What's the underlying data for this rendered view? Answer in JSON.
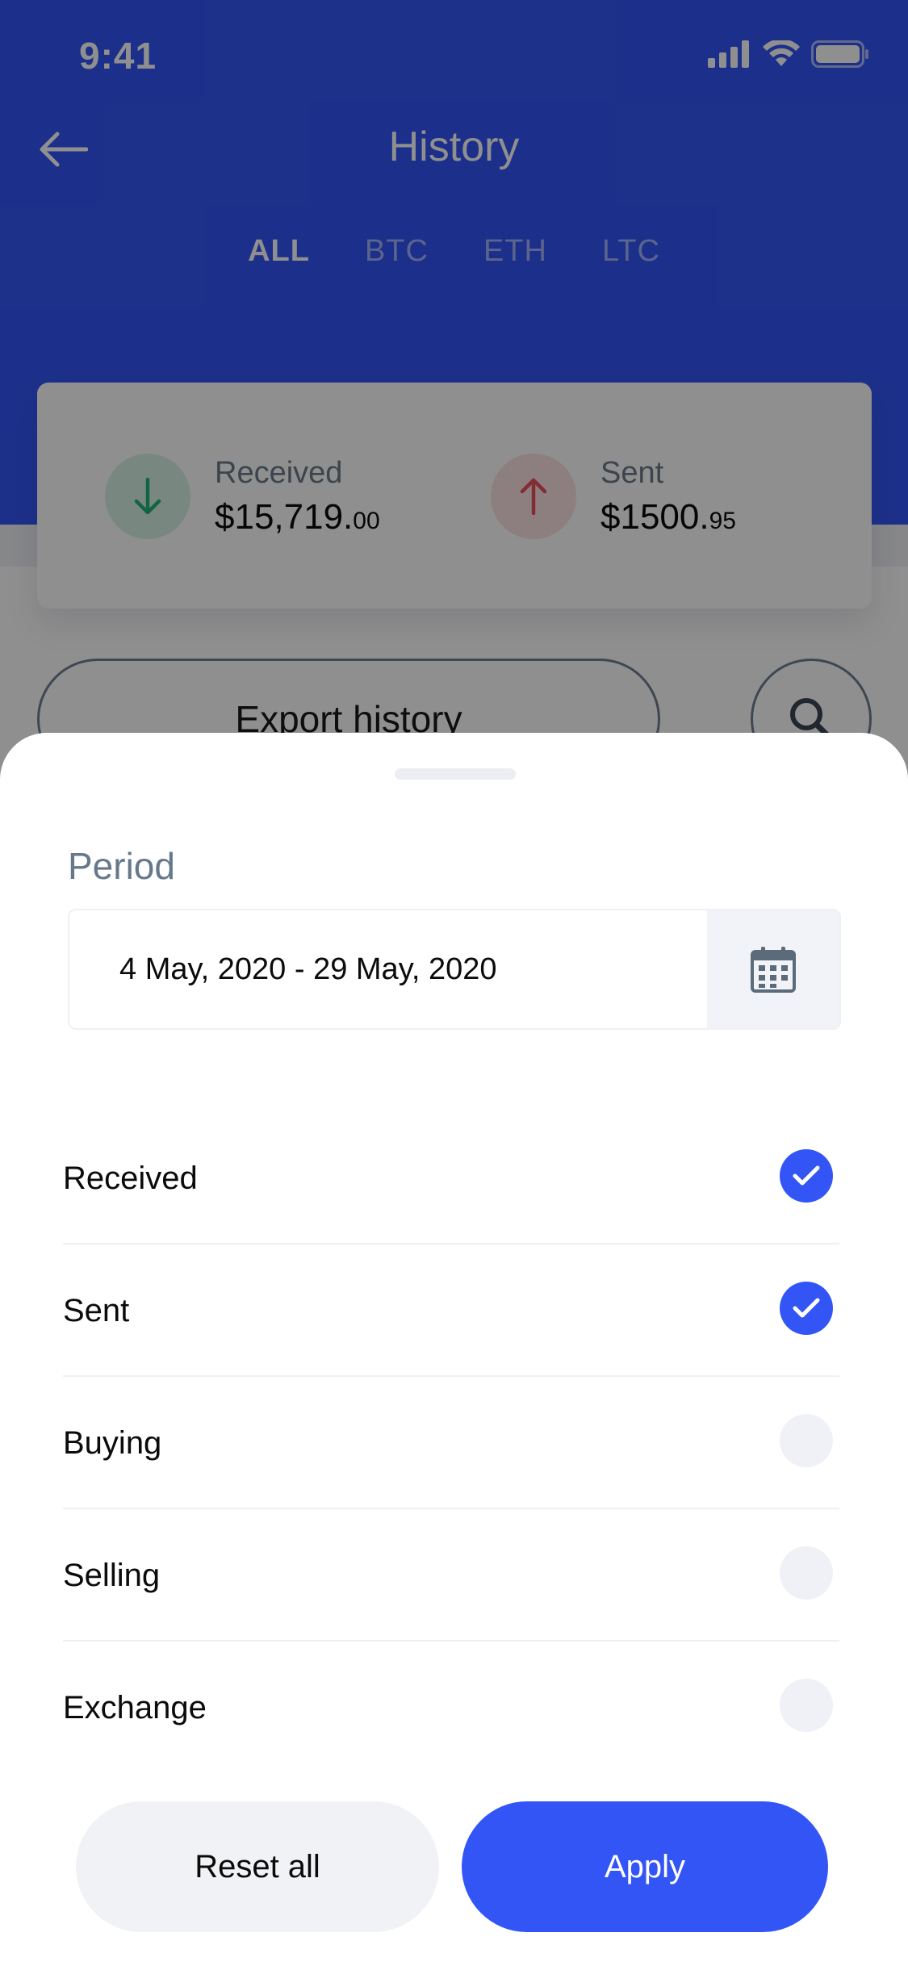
{
  "status_bar": {
    "time": "9:41"
  },
  "header": {
    "title": "History",
    "tabs": [
      {
        "label": "ALL",
        "active": true
      },
      {
        "label": "BTC",
        "active": false
      },
      {
        "label": "ETH",
        "active": false
      },
      {
        "label": "LTC",
        "active": false
      }
    ]
  },
  "summary": {
    "received": {
      "label": "Received",
      "amount": "$15,719.",
      "cents": "00"
    },
    "sent": {
      "label": "Sent",
      "amount": "$1500.",
      "cents": "95"
    }
  },
  "actions": {
    "export_label": "Export history"
  },
  "sheet": {
    "period_label": "Period",
    "date_range": "4 May, 2020 - 29 May, 2020",
    "options": [
      {
        "label": "Received",
        "checked": true
      },
      {
        "label": "Sent",
        "checked": true
      },
      {
        "label": "Buying",
        "checked": false
      },
      {
        "label": "Selling",
        "checked": false
      },
      {
        "label": "Exchange",
        "checked": false
      }
    ],
    "reset_label": "Reset all",
    "apply_label": "Apply"
  },
  "colors": {
    "primary": "#3355f6",
    "received_green": "#22b37a",
    "sent_red": "#e8505b",
    "muted_text": "#66788a"
  }
}
